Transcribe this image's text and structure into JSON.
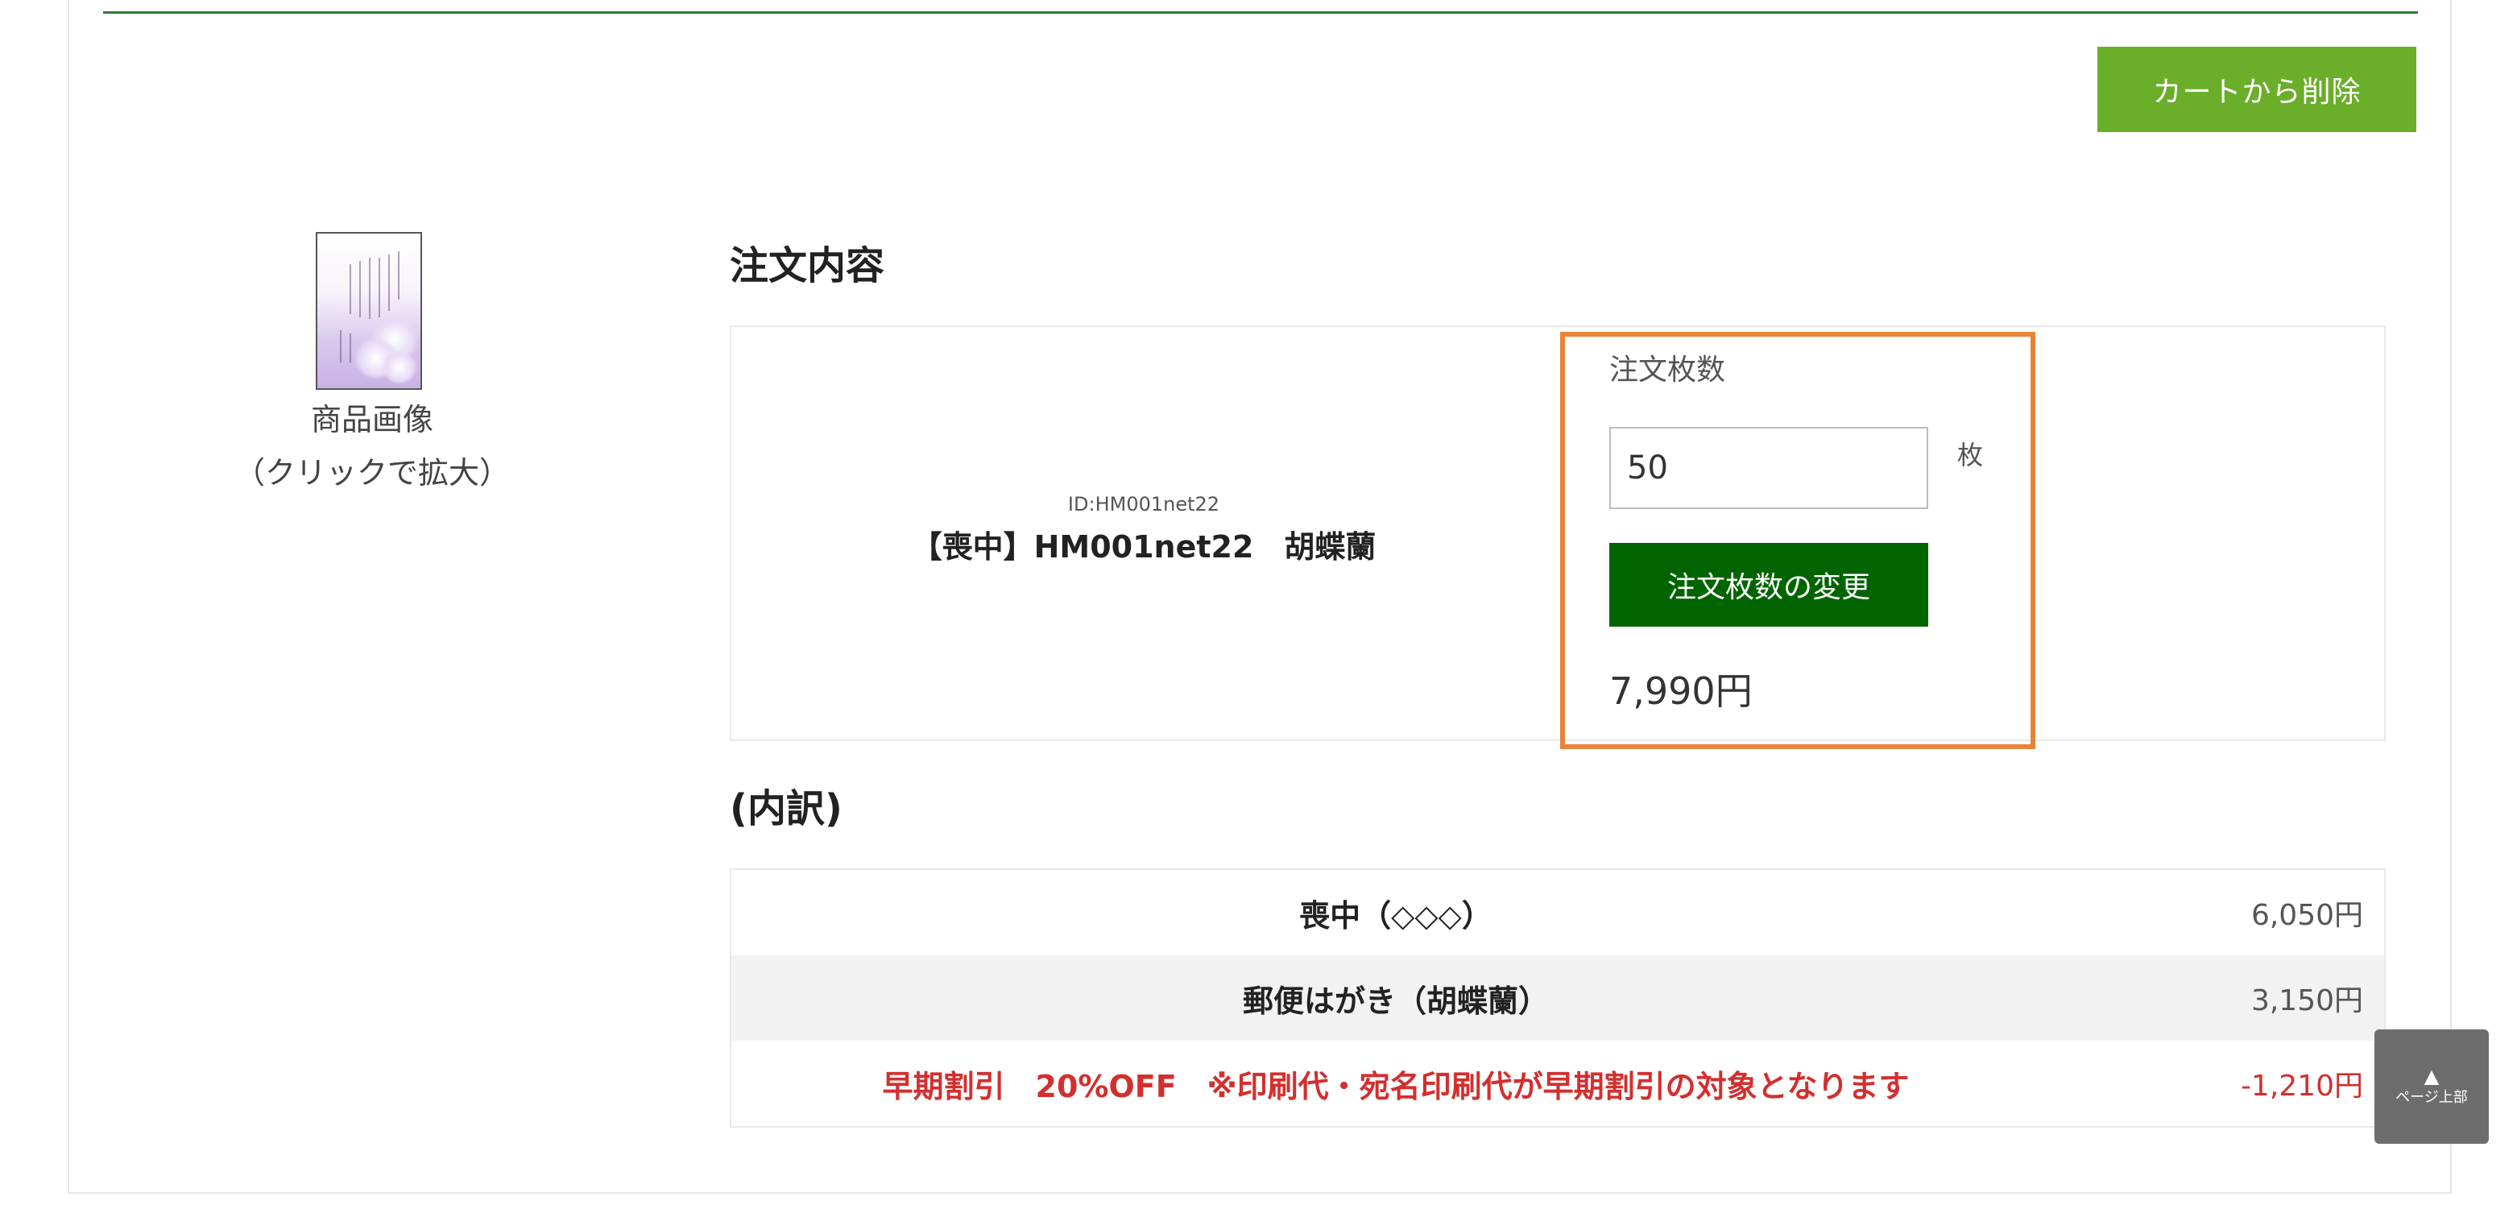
{
  "header": {
    "remove_button": "カートから削除"
  },
  "thumbnail": {
    "caption_line1": "商品画像",
    "caption_line2": "（クリックで拡大）"
  },
  "order": {
    "title": "注文内容",
    "product_id": "ID:HM001net22",
    "product_name": "【喪中】HM001net22　胡蝶蘭",
    "qty_label": "注文枚数",
    "qty_value": "50",
    "qty_unit": "枚",
    "change_button": "注文枚数の変更",
    "subtotal": "7,990円"
  },
  "breakdown": {
    "title": "(内訳)",
    "rows": [
      {
        "label": "喪中（◇◇◇）",
        "price": "6,050円"
      },
      {
        "label": "郵便はがき（胡蝶蘭）",
        "price": "3,150円"
      },
      {
        "label": "早期割引　20%OFF　※印刷代・宛名印刷代が早期割引の対象となります",
        "price": "-1,210円"
      }
    ]
  },
  "page_top": {
    "arrow": "▲",
    "label": "ページ上部"
  },
  "colors": {
    "accent_green": "#6aae2a",
    "dark_green": "#006400",
    "highlight_orange": "#e8833a",
    "discount_red": "#d32f2f"
  }
}
